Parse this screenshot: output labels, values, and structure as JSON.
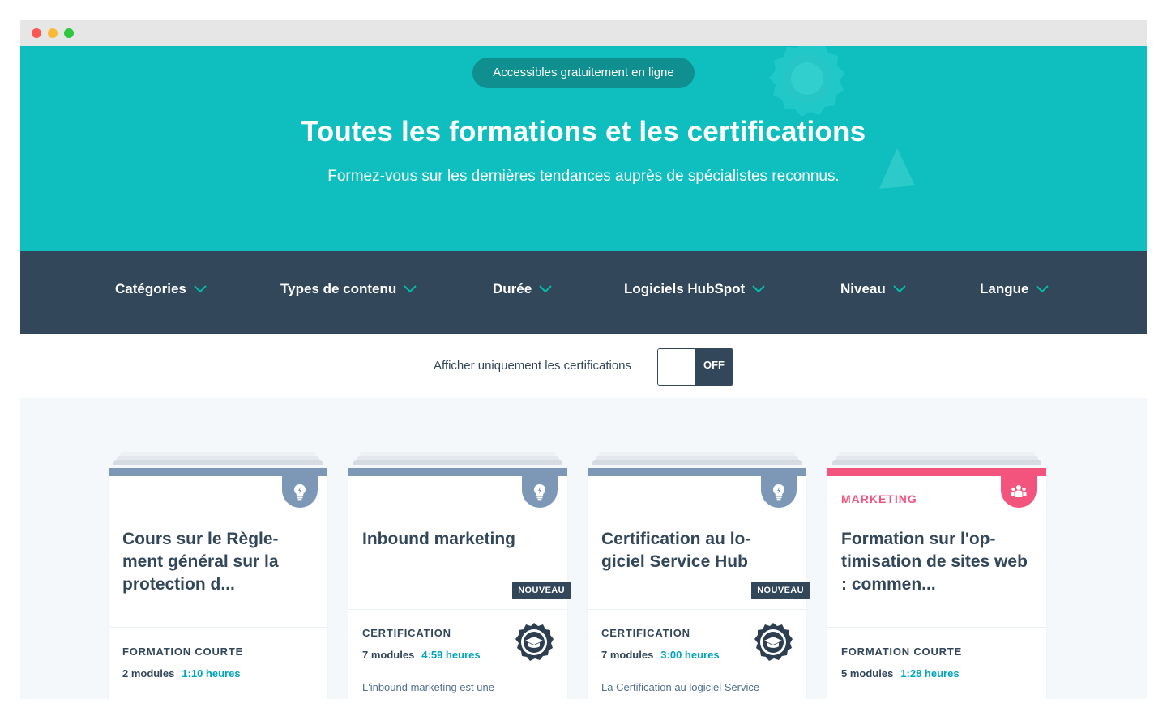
{
  "hero": {
    "badge": "Accessibles gratuitement en ligne",
    "title": "Toutes les formations et les certifications",
    "subtitle": "Formez-vous sur les dernières tendances auprès de spécialistes reconnus."
  },
  "filters": [
    {
      "label": "Catégories"
    },
    {
      "label": "Types de contenu"
    },
    {
      "label": "Durée"
    },
    {
      "label": "Logiciels HubSpot"
    },
    {
      "label": "Niveau"
    },
    {
      "label": "Langue"
    }
  ],
  "toggle": {
    "label": "Afficher uniquement les certifications",
    "state": "OFF"
  },
  "cards": [
    {
      "category": "",
      "title": "Cours sur le Règle-ment général sur la protection d...",
      "badge": "",
      "type": "FORMATION COURTE",
      "modules": "2 modules",
      "duration": "1:10 heures",
      "description": "",
      "icon": "lightbulb-icon"
    },
    {
      "category": "",
      "title": "Inbound marketing",
      "badge": "NOUVEAU",
      "type": "CERTIFICATION",
      "modules": "7 modules",
      "duration": "4:59 heures",
      "description": "L'inbound marketing est une",
      "icon": "lightbulb-icon"
    },
    {
      "category": "",
      "title": "Certification au lo-giciel Service Hub",
      "badge": "NOUVEAU",
      "type": "CERTIFICATION",
      "modules": "7 modules",
      "duration": "3:00 heures",
      "description": "La Certification au logiciel Service",
      "icon": "lightbulb-icon"
    },
    {
      "category": "MARKETING",
      "title": "Formation sur l'op-timisation de sites web : commen...",
      "badge": "",
      "type": "FORMATION COURTE",
      "modules": "5 modules",
      "duration": "1:28 heures",
      "description": "",
      "icon": "people-icon"
    }
  ],
  "colors": {
    "hero": "#0fbfbf",
    "navy": "#33475b",
    "slate": "#7c98b6",
    "pink": "#f2547d",
    "teal_text": "#00a4bd"
  }
}
